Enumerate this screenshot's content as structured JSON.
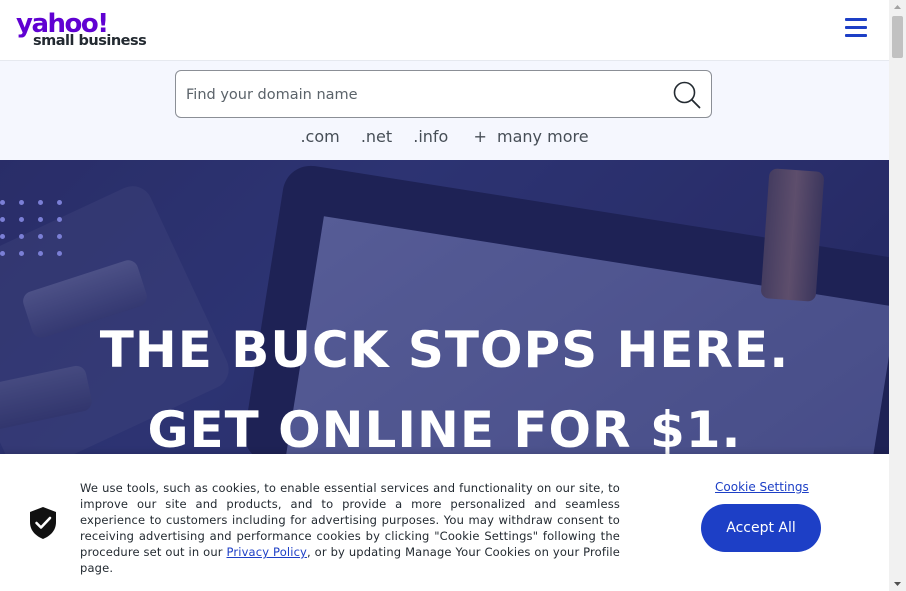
{
  "header": {
    "logo_brand": "yahoo!",
    "logo_sub": "small business",
    "menu_icon": "hamburger-menu-icon"
  },
  "search": {
    "placeholder": "Find your domain name",
    "value": "",
    "icon": "search-icon"
  },
  "tlds": [
    ".com",
    ".net",
    ".info",
    "+  many more"
  ],
  "hero": {
    "line1": "THE BUCK STOPS HERE.",
    "line2": "GET ONLINE FOR $1."
  },
  "cookie": {
    "text_before_link": "We use tools, such as cookies, to enable essential services and functionality on our site, to improve our site and products, and to provide a more personalized and seamless experience to customers including for advertising purposes. You may withdraw consent to receiving advertising and performance cookies by clicking \"Cookie Settings\" following the procedure set out in our ",
    "link_label": "Privacy Policy",
    "text_after_link": ", or by updating Manage Your Cookies on your Profile page.",
    "settings_label": "Cookie Settings",
    "accept_label": "Accept All",
    "icon": "shield-check-icon"
  },
  "colors": {
    "brand_purple": "#6001d2",
    "accent_blue": "#1d3fc6",
    "band_bg": "#f5f7fe"
  }
}
